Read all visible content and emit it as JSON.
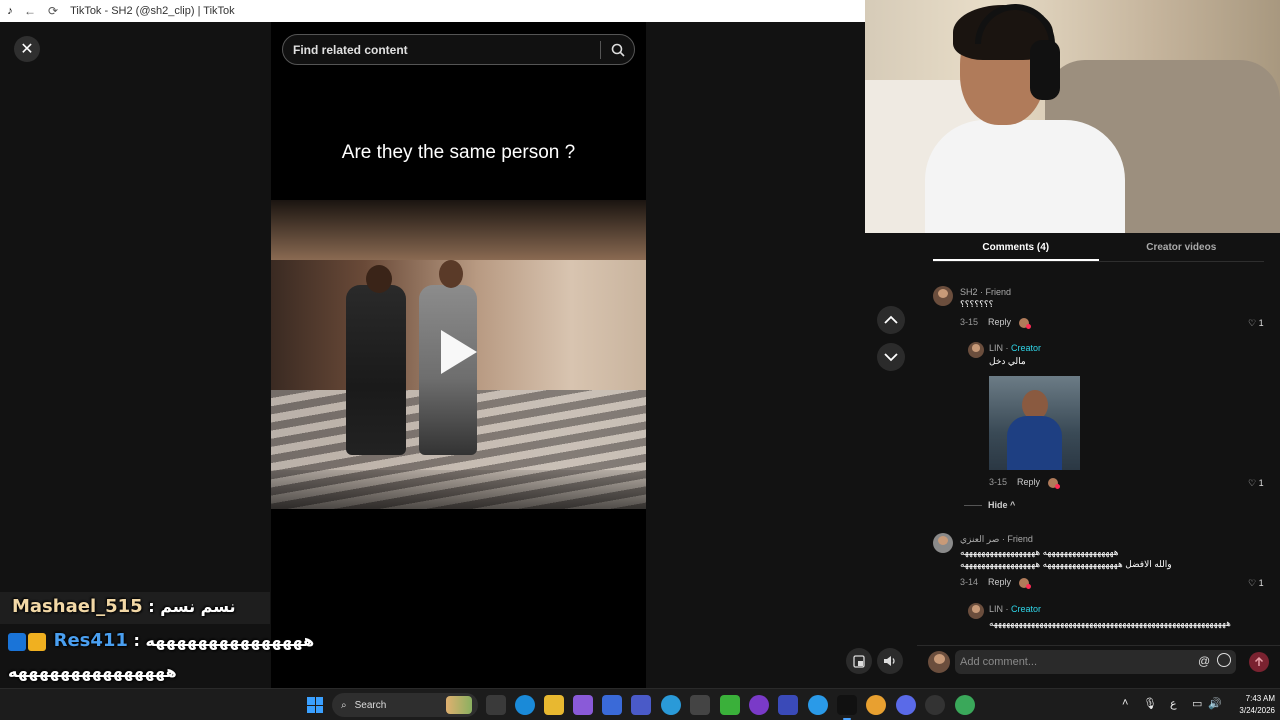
{
  "browser": {
    "title": "TikTok - SH2 (@sh2_clip) | TikTok",
    "back_label": "←",
    "reload_label": "⟳"
  },
  "player": {
    "close_label": "✕",
    "search_placeholder": "Find related content",
    "caption": "Are they the same person ?"
  },
  "panel": {
    "tabs": [
      {
        "label": "Comments (4)",
        "active": true
      },
      {
        "label": "Creator videos",
        "active": false
      }
    ],
    "comments": [
      {
        "name": "SH2",
        "tag": "Friend",
        "text": "؟؟؟؟؟؟؟",
        "date": "3-15",
        "reply": "Reply",
        "likes": "1"
      },
      {
        "name": "LIN",
        "tag": "Creator",
        "text": "مالي دخل",
        "date": "3-15",
        "reply": "Reply",
        "likes": "1"
      },
      {
        "hide_label": "Hide ^"
      },
      {
        "name": "صر العنزي",
        "tag": "Friend",
        "line1": "هههههههههههههههههه ههههههههههههههههههه",
        "line2": "والله الافضل ههههههههههههههههههه ههههههههههههههههههه",
        "date": "3-14",
        "reply": "Reply",
        "likes": "1"
      },
      {
        "name": "LIN",
        "tag": "Creator",
        "text": "هههههههههههههههههههههههههههههههههههههههههههههههههههههههههه"
      }
    ],
    "comment_placeholder": "Add comment...",
    "at_label": "@"
  },
  "chat": [
    {
      "user": "Mashael_515",
      "message": ": نسم نسم"
    },
    {
      "user": "Res411",
      "message": ": هههههههههههههههه"
    },
    {
      "message": "هههههههههههههههه"
    }
  ],
  "taskbar": {
    "search_label": "Search",
    "time": "7:43 AM",
    "date": "3/24/2026",
    "tray_lang": "ع"
  },
  "colors": {
    "accent_creator": "#2fd5e8",
    "send_button": "#7a2230",
    "taskbar_bg": "#1c1c1c"
  }
}
